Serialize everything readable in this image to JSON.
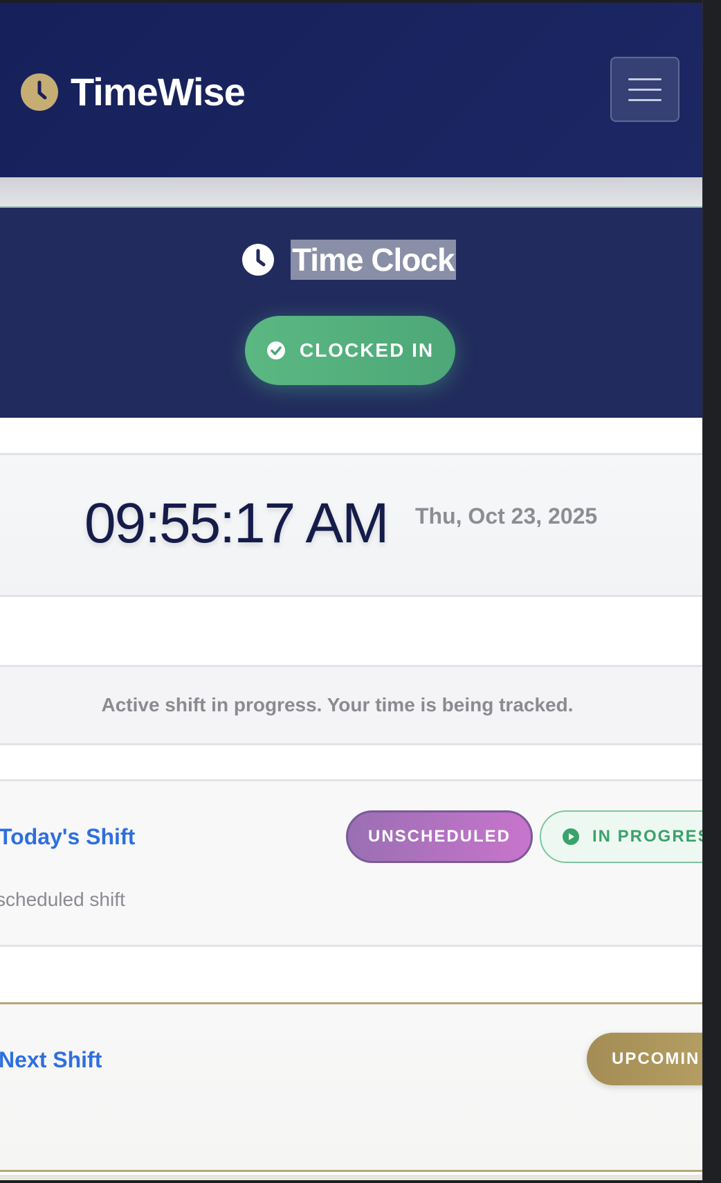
{
  "app": {
    "brand_name": "TimeWise"
  },
  "header": {
    "title": "Time Clock",
    "status": "CLOCKED IN"
  },
  "clock": {
    "time": "09:55:17 AM",
    "date": "Thu, Oct 23, 2025"
  },
  "notice": {
    "text": "Active shift in progress. Your time is being tracked."
  },
  "today_shift": {
    "title": "Today's Shift",
    "subtitle": "scheduled shift",
    "badge_type": "UNSCHEDULED",
    "badge_status": "IN PROGRES"
  },
  "next_shift": {
    "title": "Next Shift",
    "badge": "UPCOMIN"
  },
  "colors": {
    "navbar": "#16205a",
    "accent_gold": "#c6ad74",
    "status_green": "#4da778",
    "link_blue": "#2e6fe0"
  },
  "icons": {
    "brand": "clock-icon",
    "header": "clock-icon",
    "status": "check-circle-icon",
    "progress": "play-circle-icon",
    "menu": "hamburger-icon"
  }
}
